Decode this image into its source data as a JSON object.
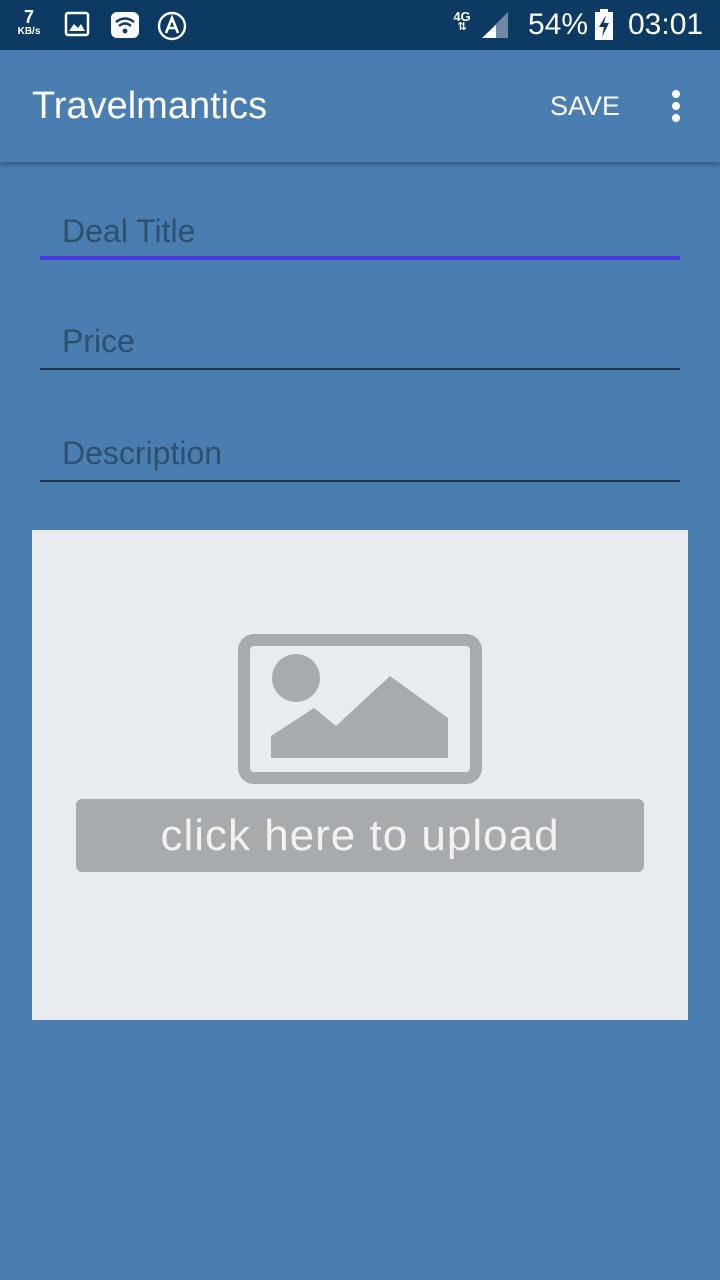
{
  "status_bar": {
    "net_speed_value": "7",
    "net_speed_unit": "KB/s",
    "network_type": "4G",
    "network_arrows": "⇅",
    "battery_percent": "54%",
    "time": "03:01"
  },
  "app_bar": {
    "title": "Travelmantics",
    "save_label": "SAVE"
  },
  "form": {
    "deal_title_placeholder": "Deal Title",
    "price_placeholder": "Price",
    "description_placeholder": "Description"
  },
  "upload": {
    "label": "click here to upload"
  },
  "colors": {
    "status_bar": "#0c3a63",
    "background": "#4a7eb0",
    "focused_underline": "#4b3ae0",
    "upload_background": "#e8ecef",
    "placeholder_icon": "#a8abad"
  },
  "icons": {
    "status_gallery": "image-icon",
    "status_wifi": "wifi-icon",
    "status_auto": "auto-a-icon",
    "status_signal": "signal-icon",
    "status_battery": "battery-charging-icon",
    "menu": "more-vert-icon",
    "upload_placeholder": "image-placeholder-icon"
  }
}
